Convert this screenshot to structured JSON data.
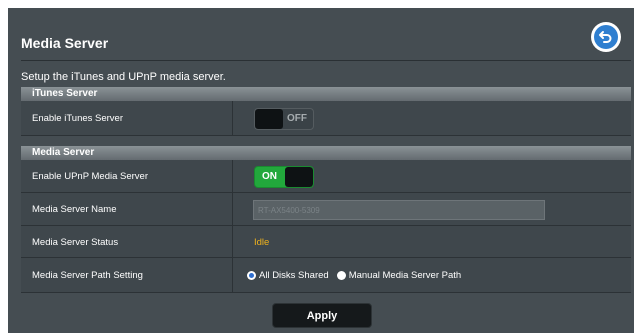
{
  "page": {
    "title": "Media Server",
    "description": "Setup the iTunes and UPnP media server."
  },
  "itunes_section": {
    "header": "iTunes Server",
    "enable_label": "Enable iTunes Server",
    "enable_state": "OFF"
  },
  "media_section": {
    "header": "Media Server",
    "upnp_label": "Enable UPnP Media Server",
    "upnp_state": "ON",
    "name_label": "Media Server Name",
    "name_value": "RT-AX5400-5309",
    "status_label": "Media Server Status",
    "status_value": "Idle",
    "path_label": "Media Server Path Setting",
    "path_options": [
      "All Disks Shared",
      "Manual Media Server Path"
    ],
    "path_selected": "All Disks Shared"
  },
  "actions": {
    "apply_label": "Apply"
  },
  "icons": {
    "back": "back-arrow-icon"
  },
  "colors": {
    "panel": "#454d52",
    "toggle_on": "#22a83c",
    "status_idle": "#f0b21c",
    "back_button": "#2f7fd0"
  }
}
